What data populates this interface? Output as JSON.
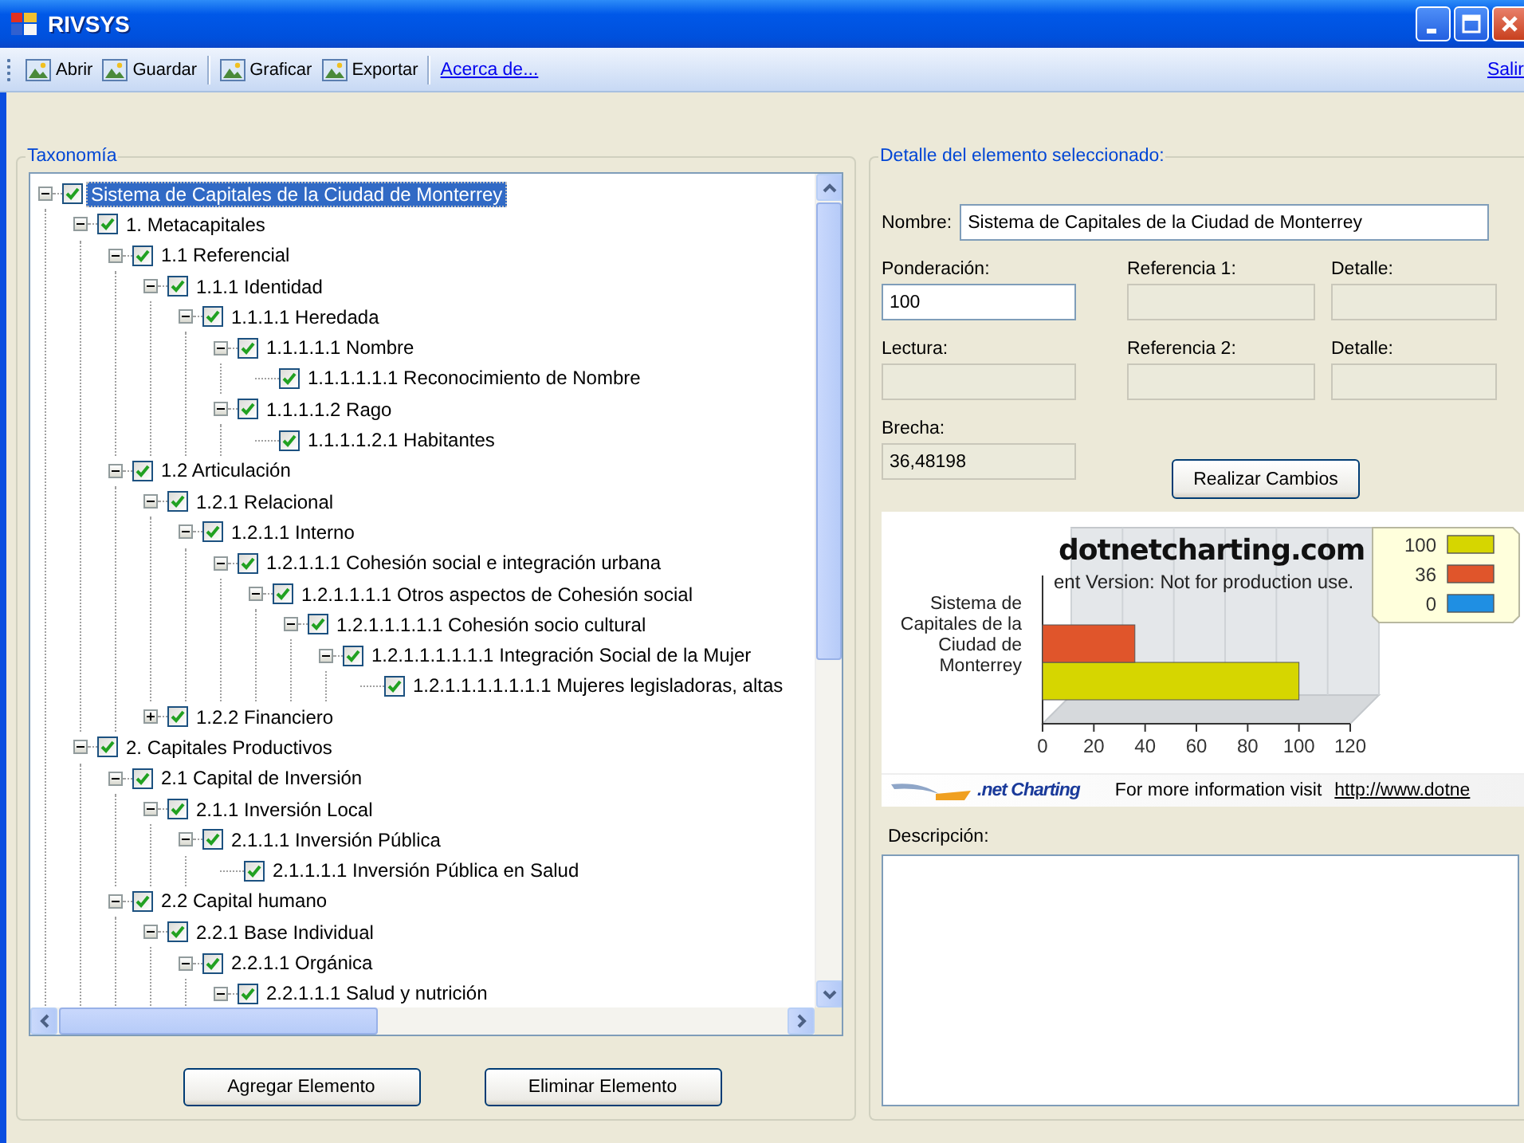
{
  "window": {
    "title": "RIVSYS"
  },
  "toolbar": {
    "items": [
      {
        "kind": "button",
        "label": "Abrir"
      },
      {
        "kind": "button",
        "label": "Guardar"
      },
      {
        "kind": "separator"
      },
      {
        "kind": "button",
        "label": "Graficar"
      },
      {
        "kind": "button",
        "label": "Exportar"
      },
      {
        "kind": "separator"
      },
      {
        "kind": "link",
        "label": "Acerca de..."
      }
    ],
    "exit_link": "Salir"
  },
  "taxonomy": {
    "title": "Taxonomía",
    "tree": [
      {
        "label": "Sistema de Capitales de la Ciudad de Monterrey",
        "checked": true,
        "expanded": true,
        "selected": true,
        "children": [
          {
            "label": "1. Metacapitales",
            "checked": true,
            "expanded": true,
            "selected": false,
            "children": [
              {
                "label": "1.1 Referencial",
                "checked": true,
                "expanded": true,
                "selected": false,
                "children": [
                  {
                    "label": "1.1.1 Identidad",
                    "checked": true,
                    "expanded": true,
                    "selected": false,
                    "children": [
                      {
                        "label": "1.1.1.1 Heredada",
                        "checked": true,
                        "expanded": true,
                        "selected": false,
                        "children": [
                          {
                            "label": "1.1.1.1.1 Nombre",
                            "checked": true,
                            "expanded": true,
                            "selected": false,
                            "children": [
                              {
                                "label": "1.1.1.1.1.1 Reconocimiento de Nombre",
                                "checked": true,
                                "selected": false
                              }
                            ]
                          },
                          {
                            "label": "1.1.1.1.2 Rago",
                            "checked": true,
                            "expanded": true,
                            "selected": false,
                            "children": [
                              {
                                "label": "1.1.1.1.2.1 Habitantes",
                                "checked": true,
                                "selected": false
                              }
                            ]
                          }
                        ]
                      }
                    ]
                  }
                ]
              },
              {
                "label": "1.2 Articulación",
                "checked": true,
                "expanded": true,
                "selected": false,
                "children": [
                  {
                    "label": "1.2.1 Relacional",
                    "checked": true,
                    "expanded": true,
                    "selected": false,
                    "children": [
                      {
                        "label": "1.2.1.1 Interno",
                        "checked": true,
                        "expanded": true,
                        "selected": false,
                        "children": [
                          {
                            "label": "1.2.1.1.1 Cohesión social e integración urbana",
                            "checked": true,
                            "expanded": true,
                            "selected": false,
                            "children": [
                              {
                                "label": "1.2.1.1.1.1 Otros aspectos de Cohesión social",
                                "checked": true,
                                "expanded": true,
                                "selected": false,
                                "children": [
                                  {
                                    "label": "1.2.1.1.1.1.1 Cohesión socio cultural",
                                    "checked": true,
                                    "expanded": true,
                                    "selected": false,
                                    "children": [
                                      {
                                        "label": "1.2.1.1.1.1.1.1 Integración Social de la Mujer",
                                        "checked": true,
                                        "expanded": true,
                                        "selected": false,
                                        "children": [
                                          {
                                            "label": "1.2.1.1.1.1.1.1.1 Mujeres legisladoras, altas",
                                            "checked": true,
                                            "selected": false
                                          }
                                        ]
                                      }
                                    ]
                                  }
                                ]
                              }
                            ]
                          }
                        ]
                      }
                    ]
                  },
                  {
                    "label": "1.2.2 Financiero",
                    "checked": true,
                    "expanded": false,
                    "selected": false
                  }
                ]
              }
            ]
          },
          {
            "label": "2. Capitales Productivos",
            "checked": true,
            "expanded": true,
            "selected": false,
            "children": [
              {
                "label": "2.1 Capital de Inversión",
                "checked": true,
                "expanded": true,
                "selected": false,
                "children": [
                  {
                    "label": "2.1.1 Inversión Local",
                    "checked": true,
                    "expanded": true,
                    "selected": false,
                    "children": [
                      {
                        "label": "2.1.1.1 Inversión Pública",
                        "checked": true,
                        "expanded": true,
                        "selected": false,
                        "children": [
                          {
                            "label": "2.1.1.1.1 Inversión Pública en Salud",
                            "checked": true,
                            "selected": false
                          }
                        ]
                      }
                    ]
                  }
                ]
              },
              {
                "label": "2.2 Capital humano",
                "checked": true,
                "expanded": true,
                "selected": false,
                "children": [
                  {
                    "label": "2.2.1 Base Individual",
                    "checked": true,
                    "expanded": true,
                    "selected": false,
                    "children": [
                      {
                        "label": "2.2.1.1 Orgánica",
                        "checked": true,
                        "expanded": true,
                        "selected": false,
                        "children": [
                          {
                            "label": "2.2.1.1.1 Salud y nutrición",
                            "checked": true,
                            "expanded": true,
                            "selected": false
                          }
                        ]
                      }
                    ]
                  }
                ]
              }
            ]
          }
        ]
      }
    ],
    "buttons": [
      "Agregar Elemento",
      "Eliminar Elemento"
    ]
  },
  "detail": {
    "title": "Detalle del elemento seleccionado:",
    "nombre": {
      "label": "Nombre:",
      "value": "Sistema de Capitales de la Ciudad de Monterrey",
      "disabled": false
    },
    "ponderacion": {
      "label": "Ponderación:",
      "value": "100",
      "disabled": false
    },
    "referencia_1": {
      "label": "Referencia 1:",
      "disabled": true
    },
    "detalle_1": {
      "label": "Detalle:",
      "disabled": true
    },
    "lectura": {
      "label": "Lectura:",
      "disabled": true
    },
    "referencia_2": {
      "label": "Referencia 2:",
      "disabled": true
    },
    "detalle_2": {
      "label": "Detalle:",
      "disabled": true
    },
    "brecha": {
      "label": "Brecha:",
      "value": "36,48198",
      "disabled": true
    },
    "apply_button": "Realizar Cambios",
    "chart": {
      "watermark_title": "dotnetcharting.com",
      "watermark_note": "ent Version: Not for production use.",
      "footer_logo": ".net Charting",
      "footer_text": "For more information visit",
      "footer_link": "http://www.dotne",
      "chart_data": {
        "type": "bar",
        "orientation": "horizontal",
        "categories": [
          "Sistema de Capitales de la Ciudad de Monterrey"
        ],
        "series": [
          {
            "name": "100",
            "color": "#d6d600",
            "values": [
              100
            ]
          },
          {
            "name": "36",
            "color": "#e0552b",
            "values": [
              36
            ]
          },
          {
            "name": "0",
            "color": "#1f8fe3",
            "values": [
              0
            ]
          }
        ],
        "xlim": [
          0,
          120
        ],
        "xticks": [
          0,
          20,
          40,
          60,
          80,
          100,
          120
        ],
        "legend": "right"
      }
    },
    "description": {
      "label": "Descripción:"
    }
  }
}
